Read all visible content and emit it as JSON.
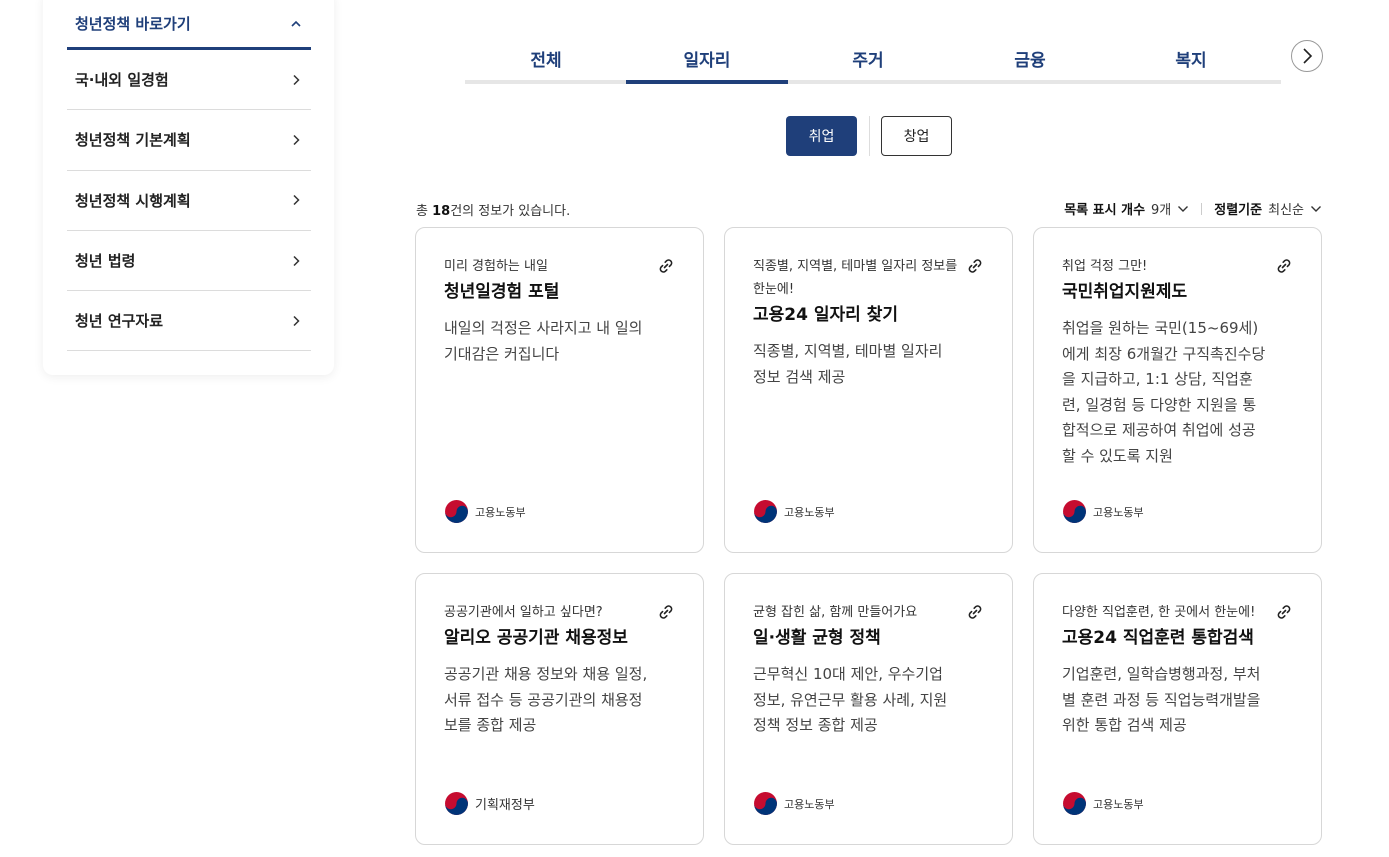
{
  "sidebar": {
    "title": "청년정책 바로가기",
    "items": [
      {
        "label": "국·내외 일경험"
      },
      {
        "label": "청년정책 기본계획"
      },
      {
        "label": "청년정책 시행계획"
      },
      {
        "label": "청년 법령"
      },
      {
        "label": "청년 연구자료"
      }
    ]
  },
  "tabs": [
    {
      "label": "전체"
    },
    {
      "label": "일자리"
    },
    {
      "label": "주거"
    },
    {
      "label": "금융"
    },
    {
      "label": "복지"
    }
  ],
  "active_tab": "일자리",
  "subtabs": [
    {
      "label": "취업"
    },
    {
      "label": "창업"
    }
  ],
  "listing": {
    "count_prefix": "총 ",
    "count": "18",
    "count_suffix": "건의 정보가 있습니다.",
    "page_size_label": "목록 표시 개수",
    "page_size_value": "9개",
    "sort_label": "정렬기준",
    "sort_value": "최신순"
  },
  "cards": [
    {
      "subtitle": "미리 경험하는 내일",
      "title": "청년일경험 포털",
      "desc": "내일의 걱정은 사라지고 내 일의 기대감은 커집니다",
      "org": "고용노동부"
    },
    {
      "subtitle": "직종별, 지역별, 테마별 일자리 정보를 한눈에!",
      "title": "고용24 일자리 찾기",
      "desc": "직종별, 지역별, 테마별 일자리 정보 검색 제공",
      "org": "고용노동부"
    },
    {
      "subtitle": "취업 걱정 그만!",
      "title": "국민취업지원제도",
      "desc": "취업을 원하는 국민(15~69세)에게 최장 6개월간 구직촉진수당을 지급하고, 1:1 상담, 직업훈련, 일경험 등 다양한 지원을 통합적으로 제공하여 취업에 성공할 수 있도록 지원",
      "org": "고용노동부"
    },
    {
      "subtitle": "공공기관에서 일하고 싶다면?",
      "title": "알리오 공공기관 채용정보",
      "desc": "공공기관 채용 정보와 채용 일정, 서류 접수 등 공공기관의 채용정보를 종합 제공",
      "org": "기획재정부"
    },
    {
      "subtitle": "균형 잡힌 삶, 함께 만들어가요",
      "title": "일·생활 균형 정책",
      "desc": "근무혁신 10대 제안, 우수기업 정보, 유연근무 활용 사례, 지원정책 정보 종합 제공",
      "org": "고용노동부"
    },
    {
      "subtitle": "다양한 직업훈련, 한 곳에서 한눈에!",
      "title": "고용24 직업훈련 통합검색",
      "desc": "기업훈련, 일학습병행과정, 부처별 훈련 과정 등 직업능력개발을 위한 통합 검색 제공",
      "org": "고용노동부"
    }
  ],
  "colors": {
    "brand": "#1f3f7a",
    "border": "#d7d7d7",
    "emblem_red": "#c60c30",
    "emblem_blue": "#003478"
  }
}
